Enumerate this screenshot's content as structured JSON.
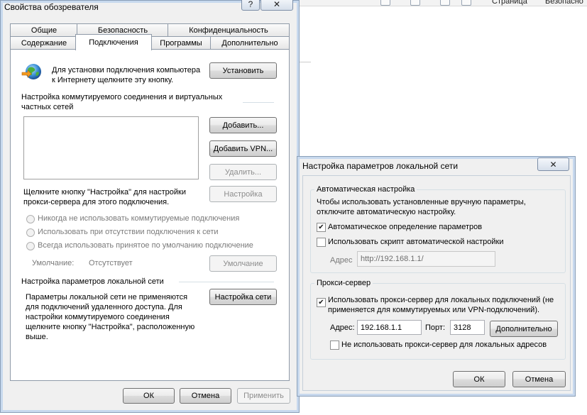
{
  "background": {
    "toolbar_page": "Страница",
    "toolbar_security": "Безопасно"
  },
  "main_dialog": {
    "title": "Свойства обозревателя",
    "help_glyph": "?",
    "close_glyph": "✕",
    "tabs_row1": [
      "Общие",
      "Безопасность",
      "Конфиденциальность"
    ],
    "tabs_row2": [
      "Содержание",
      "Подключения",
      "Программы",
      "Дополнительно"
    ],
    "setup_text": "Для установки подключения компьютера к Интернету щелкните эту кнопку.",
    "install_button": "Установить",
    "dialup_section": "Настройка коммутируемого соединения и виртуальных частных сетей",
    "add_button": "Добавить...",
    "add_vpn_button": "Добавить VPN...",
    "delete_button": "Удалить...",
    "settings_hint": "Щелкните кнопку \"Настройка\" для настройки прокси-сервера для этого подключения.",
    "settings_button": "Настройка",
    "radio_never": "Никогда не использовать коммутируемые подключения",
    "radio_absent": "Использовать при отсутствии подключения к сети",
    "radio_always": "Всегда использовать принятое по умолчанию подключение",
    "default_label": "Умолчание:",
    "default_value": "Отсутствует",
    "default_button": "Умолчание",
    "lan_section": "Настройка параметров локальной сети",
    "lan_text": "Параметры локальной сети не применяются для подключений удаленного доступа. Для настройки коммутируемого соединения щелкните кнопку \"Настройка\", расположенную выше.",
    "lan_button": "Настройка сети",
    "ok_button": "ОК",
    "cancel_button": "Отмена",
    "apply_button": "Применить"
  },
  "lan_dialog": {
    "title": "Настройка параметров локальной сети",
    "close_glyph": "✕",
    "auto_group": "Автоматическая настройка",
    "auto_text": "Чтобы использовать установленные вручную параметры, отключите автоматическую настройку.",
    "auto_detect_label": "Автоматическое определение параметров",
    "auto_detect_checked": true,
    "use_script_label": "Использовать скрипт автоматической настройки",
    "use_script_checked": false,
    "address_label": "Адрес",
    "script_address": "http://192.168.1.1/",
    "proxy_group": "Прокси-сервер",
    "use_proxy_label": "Использовать прокси-сервер для локальных подключений (не применяется для коммутируемых или VPN-подключений).",
    "use_proxy_checked": true,
    "proxy_address_label": "Адрес:",
    "proxy_address": "192.168.1.1",
    "port_label": "Порт:",
    "port": "3128",
    "advanced_button": "Дополнительно",
    "bypass_label": "Не использовать прокси-сервер для локальных адресов",
    "bypass_checked": false,
    "ok_button": "ОК",
    "cancel_button": "Отмена",
    "check_glyph": "✔"
  }
}
